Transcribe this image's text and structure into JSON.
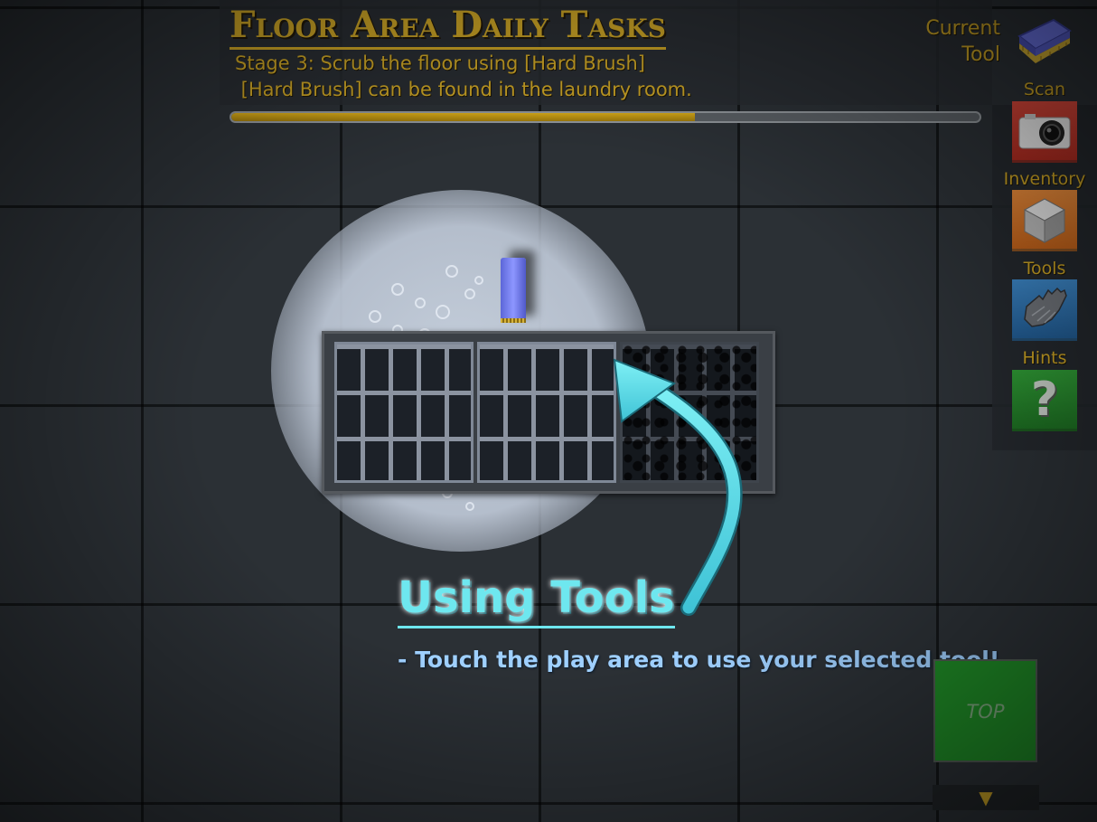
{
  "task": {
    "title": "Floor Area Daily Tasks",
    "stage": "Stage 3: Scrub the floor using [Hard Brush]",
    "location_hint": " [Hard Brush] can be found in the laundry room.",
    "progress_fraction": 0.62
  },
  "current_tool": {
    "label": "Current\nTool",
    "icon": "hard-brush-icon"
  },
  "side_menu": {
    "scan": {
      "label": "Scan",
      "icon": "camera-icon",
      "color": "#c8362b"
    },
    "inventory": {
      "label": "Inventory",
      "icon": "box-icon",
      "color": "#d97529"
    },
    "tools": {
      "label": "Tools",
      "icon": "glove-icon",
      "color": "#2e71ad"
    },
    "hints": {
      "label": "Hints",
      "icon": "question-mark-icon",
      "glyph": "?",
      "color": "#27852c"
    }
  },
  "tutorial": {
    "title": "Using Tools",
    "text": "- Touch the play area to use your selected tool!",
    "accent": "#6ee7ef"
  },
  "view_controls": {
    "top_label": "TOP",
    "scroll_glyph": "▼"
  },
  "colors": {
    "gold": "#c9a225",
    "tutorial_text": "#9fd0ff"
  }
}
